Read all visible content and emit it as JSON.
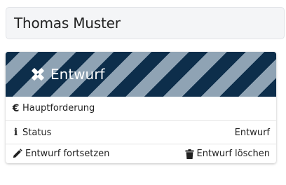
{
  "header": {
    "name": "Thomas Muster"
  },
  "card": {
    "banner_title": "Entwurf",
    "banner_icon": "pencil-ruler-icon",
    "colors": {
      "banner_dark": "#0d2e4b",
      "banner_light": "#8fa3b4"
    },
    "claim_icon_text": "€",
    "claim_label": "Hauptforderung",
    "status_icon_text": "i",
    "status_label": "Status",
    "status_value": "Entwurf",
    "continue_label": "Entwurf fortsetzen",
    "continue_icon": "pencil-icon",
    "delete_label": "Entwurf löschen",
    "delete_icon": "trash-icon"
  }
}
